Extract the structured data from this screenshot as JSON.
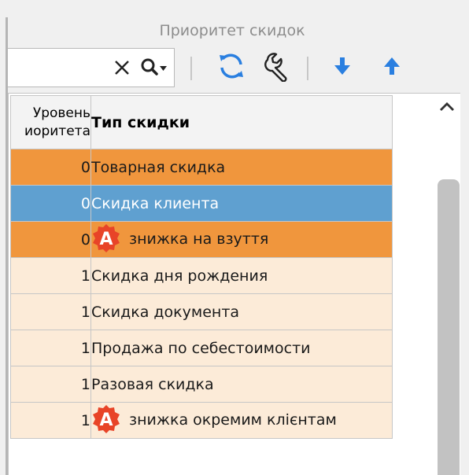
{
  "panel": {
    "title": "Приоритет скидок"
  },
  "search": {
    "value": ""
  },
  "grid": {
    "columns": {
      "level": [
        "Уровень",
        "иоритета"
      ],
      "type": "Тип скидки"
    },
    "rows": [
      {
        "level": "0",
        "type": "Товарная скидка",
        "style": "orange",
        "badge": false
      },
      {
        "level": "0",
        "type": "Скидка клиента",
        "style": "selected",
        "badge": false
      },
      {
        "level": "0",
        "type": "знижка на взуття",
        "style": "orange",
        "badge": true
      },
      {
        "level": "1",
        "type": "Скидка дня рождения",
        "style": "light",
        "badge": false
      },
      {
        "level": "1",
        "type": "Скидка документа",
        "style": "light",
        "badge": false
      },
      {
        "level": "1",
        "type": "Продажа по себестоимости",
        "style": "light",
        "badge": false
      },
      {
        "level": "1",
        "type": "Разовая скидка",
        "style": "light",
        "badge": false
      },
      {
        "level": "1",
        "type": "знижка  окремим клієнтам",
        "style": "light",
        "badge": true
      }
    ]
  },
  "badge": {
    "letter": "A",
    "color": "#e84428"
  },
  "colors": {
    "orange_row": "#f0963d",
    "selected_row": "#5fa0d0",
    "light_row": "#fcebd8",
    "icon_blue": "#2a7fe0"
  },
  "icons": {
    "clear": "close-icon",
    "search": "search-icon",
    "refresh": "refresh-icon",
    "settings": "wrench-icon",
    "move_down": "arrow-down-icon",
    "move_up": "arrow-up-icon",
    "scroll_up": "chevron-up-icon",
    "badge": "auto-discount-icon"
  }
}
